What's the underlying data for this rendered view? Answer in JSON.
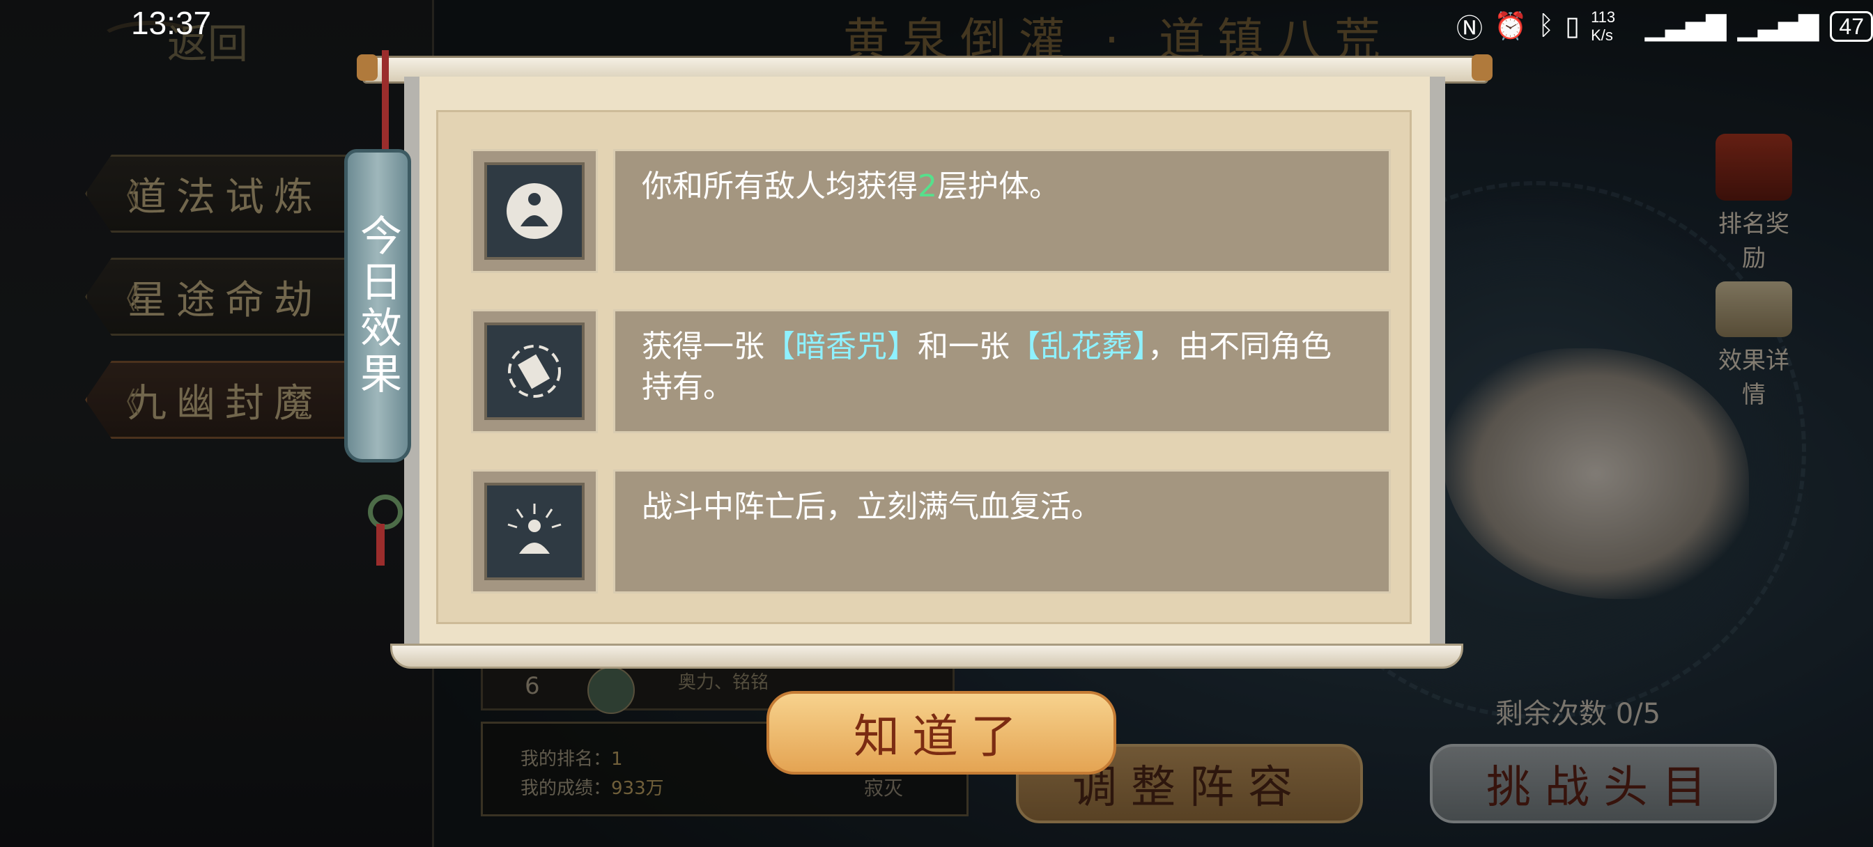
{
  "status_bar": {
    "time": "13:37",
    "network_speed": "113 K/s",
    "battery": "47"
  },
  "header": {
    "back_label": "返回",
    "title": "黄泉倒灌 · 道镇八荒"
  },
  "mode_tabs": [
    {
      "label": "道法试炼",
      "active": false
    },
    {
      "label": "星途命劫",
      "active": false
    },
    {
      "label": "九幽封魔",
      "active": true
    }
  ],
  "right_side": {
    "rank_reward_label": "排名奖励",
    "effect_detail_label": "效果详情",
    "remaining_label": "剩余次数",
    "remaining_value": "0/5"
  },
  "bottom_buttons": {
    "adjust_lineup": "调整阵容",
    "challenge_boss": "挑战头目"
  },
  "leaderboard": {
    "row": {
      "rank": "6",
      "name": "奥力、铭铭"
    },
    "my_rank_label": "我的排名：",
    "my_rank_value": "1",
    "my_score_label": "我的成绩：",
    "my_score_value": "933万",
    "player_tag": "寂灭"
  },
  "modal": {
    "tag_label": "今日效果",
    "effects": [
      {
        "icon": "meditation-icon",
        "parts": [
          "你和所有敌人均获得",
          "2",
          "层护体。"
        ]
      },
      {
        "icon": "swirl-card-icon",
        "parts": [
          "获得一张",
          "【暗香咒】",
          "和一张",
          "【乱花葬】",
          "，由不同角色持有。"
        ]
      },
      {
        "icon": "radiant-meditation-icon",
        "parts": [
          "战斗中阵亡后，立刻满气血复活。"
        ]
      }
    ],
    "confirm_label": "知道了"
  },
  "colors": {
    "highlight_number": "#56e08c",
    "highlight_card": "#8ef1ff",
    "confirm_text": "#7b2b12"
  }
}
